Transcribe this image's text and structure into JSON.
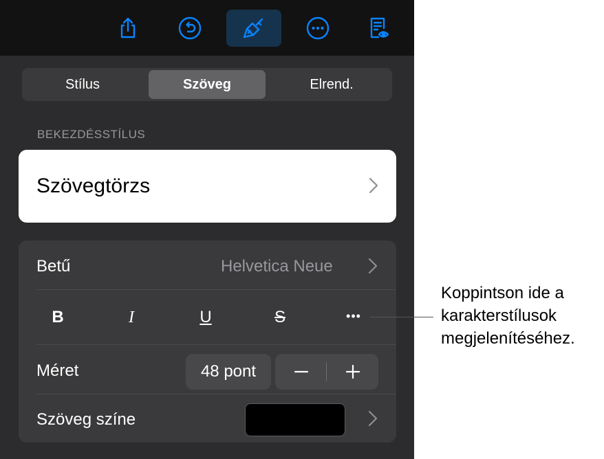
{
  "tabs": [
    {
      "label": "Stílus",
      "selected": false
    },
    {
      "label": "Szöveg",
      "selected": true
    },
    {
      "label": "Elrend.",
      "selected": false
    }
  ],
  "paragraph_style": {
    "section_label": "BEKEZDÉSSTÍLUS",
    "value": "Szövegtörzs"
  },
  "font": {
    "label": "Betű",
    "value": "Helvetica Neue"
  },
  "format_buttons": {
    "bold": "B",
    "italic": "I",
    "underline": "U",
    "strikethrough": "S",
    "more": "•••"
  },
  "size": {
    "label": "Méret",
    "value": "48 pont",
    "decrement": "−",
    "increment": "+"
  },
  "text_color": {
    "label": "Szöveg színe",
    "swatch": "#000000"
  },
  "callout": {
    "lines": [
      "Koppintson ide a",
      "karakterstílusok",
      "megjelenítéséhez."
    ]
  },
  "colors": {
    "accent": "#0a84ff",
    "toolbar_bg": "#121212",
    "panel_bg": "#2c2c2e"
  },
  "toolbar_icons": [
    "share-icon",
    "undo-icon",
    "paintbrush-icon",
    "more-icon",
    "reader-view-icon"
  ]
}
